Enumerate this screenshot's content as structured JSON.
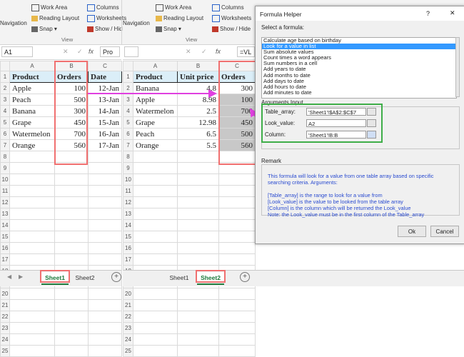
{
  "left_ribbon": {
    "navigation": "Navigation",
    "work_area": "Work Area",
    "reading_layout": "Reading Layout",
    "snap": "Snap",
    "columns": "Columns",
    "worksheets": "Worksheets",
    "show_hide": "Show / Hid",
    "group_label": "View"
  },
  "right_ribbon": {
    "navigation": "Navigation",
    "work_area": "Work Area",
    "reading_layout": "Reading Layout",
    "snap": "Snap",
    "columns": "Columns",
    "worksheets": "Worksheets",
    "show_hide": "Show / Hide",
    "group_label": "View"
  },
  "left_formula_bar": {
    "name_box": "A1",
    "value": "Pro",
    "fx": "fx"
  },
  "right_formula_bar": {
    "fx": "fx",
    "value": "=VL"
  },
  "sheet1": {
    "col_headers": [
      "A",
      "B",
      "C"
    ],
    "headers": [
      "Product",
      "Orders",
      "Date"
    ],
    "rows": [
      [
        "Apple",
        "100",
        "12-Jan"
      ],
      [
        "Peach",
        "500",
        "13-Jan"
      ],
      [
        "Banana",
        "300",
        "14-Jan"
      ],
      [
        "Grape",
        "450",
        "15-Jan"
      ],
      [
        "Watermelon",
        "700",
        "16-Jan"
      ],
      [
        "Orange",
        "560",
        "17-Jan"
      ]
    ],
    "row_numbers": [
      "1",
      "2",
      "3",
      "4",
      "5",
      "6",
      "7",
      "8",
      "9",
      "10",
      "11",
      "12",
      "13",
      "14",
      "15",
      "16",
      "17",
      "18",
      "19",
      "20",
      "21",
      "22",
      "23",
      "24",
      "25"
    ]
  },
  "sheet2": {
    "col_headers": [
      "A",
      "B",
      "C"
    ],
    "headers": [
      "Product",
      "Unit price",
      "Orders"
    ],
    "rows": [
      [
        "Banana",
        "4.8",
        "300"
      ],
      [
        "Apple",
        "8.98",
        "100"
      ],
      [
        "Watermelon",
        "2.5",
        "700"
      ],
      [
        "Grape",
        "12.98",
        "450"
      ],
      [
        "Peach",
        "6.5",
        "500"
      ],
      [
        "Orange",
        "5.5",
        "560"
      ]
    ],
    "row_numbers": [
      "1",
      "2",
      "3",
      "4",
      "5",
      "6",
      "7",
      "8",
      "9",
      "10",
      "11",
      "12",
      "13",
      "14",
      "15",
      "16",
      "17",
      "18",
      "19",
      "20",
      "21",
      "22",
      "23",
      "24",
      "25"
    ]
  },
  "tabs_left": {
    "sheet1": "Sheet1",
    "sheet2": "Sheet2",
    "add": "+"
  },
  "tabs_right": {
    "sheet1": "Sheet1",
    "sheet2": "Sheet2",
    "add": "+"
  },
  "dialog": {
    "title": "Formula Helper",
    "help": "?",
    "close": "✕",
    "select_label": "Select a formula:",
    "formulas": [
      "Calculate age based on birthday",
      "Look for a value in list",
      "Sum absolute values",
      "Count times a word appears",
      "Sum numbers in a cell",
      "Add years to date",
      "Add months to date",
      "Add days to date",
      "Add hours to date",
      "Add minutes to date"
    ],
    "selected_index": 1,
    "args_label": "Arguments Input",
    "args": [
      {
        "label": "Table_array:",
        "value": "'Sheet1'!$A$2:$C$7"
      },
      {
        "label": "Look_value:",
        "value": "A2"
      },
      {
        "label": "Column:",
        "value": "'Sheet1'!B:B"
      }
    ],
    "remark_label": "Remark",
    "remark_lines": [
      "This formula will look for a value from one table array based on specific",
      "searching criteria. Arguments:",
      "",
      "[Table_array] is the range to look for a value from",
      "[Look_value] is the value to be looked from the table array",
      "[Column] is the column which will be returned the Look_value",
      "Note: the Look_value must be in the first column of the Table_array"
    ],
    "ok": "Ok",
    "cancel": "Cancel"
  },
  "colors": {
    "header_fill": "#dbeef8",
    "highlight_red": "#f07070",
    "arrow_magenta": "#e040e0",
    "green_box": "#3fae49",
    "tab_green": "#1e7a3c",
    "list_select": "#3399ff"
  }
}
